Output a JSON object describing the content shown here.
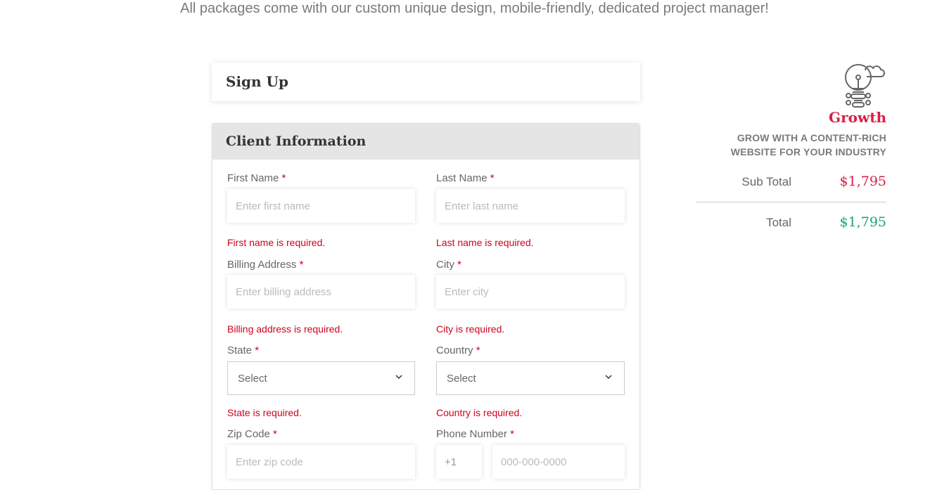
{
  "tagline": "All packages come with our custom unique design, mobile-friendly, dedicated project manager!",
  "signup_title": "Sign Up",
  "client_section_title": "Client Information",
  "required_mark": "*",
  "form": {
    "first_name": {
      "label": "First Name",
      "placeholder": "Enter first name",
      "error": "First name is required."
    },
    "last_name": {
      "label": "Last Name",
      "placeholder": "Enter last name",
      "error": "Last name is required."
    },
    "billing_address": {
      "label": "Billing Address",
      "placeholder": "Enter billing address",
      "error": "Billing address is required."
    },
    "city": {
      "label": "City",
      "placeholder": "Enter city",
      "error": "City is required."
    },
    "state": {
      "label": "State",
      "value": "Select",
      "error": "State is required."
    },
    "country": {
      "label": "Country",
      "value": "Select",
      "error": "Country is required."
    },
    "zip": {
      "label": "Zip Code",
      "placeholder": "Enter zip code"
    },
    "phone": {
      "label": "Phone Number",
      "code": "+1",
      "placeholder": "000-000-0000"
    }
  },
  "summary": {
    "icon": "lightbulb-cloud-icon",
    "plan_name": "Growth",
    "plan_desc_line1": "GROW WITH A CONTENT-RICH",
    "plan_desc_line2": "WEBSITE FOR YOUR INDUSTRY",
    "subtotal_label": "Sub Total",
    "subtotal_value": "$1,795",
    "total_label": "Total",
    "total_value": "$1,795"
  },
  "colors": {
    "accent_red": "#d81f45",
    "accent_green": "#1aa37a",
    "error_red": "#d0021b"
  }
}
